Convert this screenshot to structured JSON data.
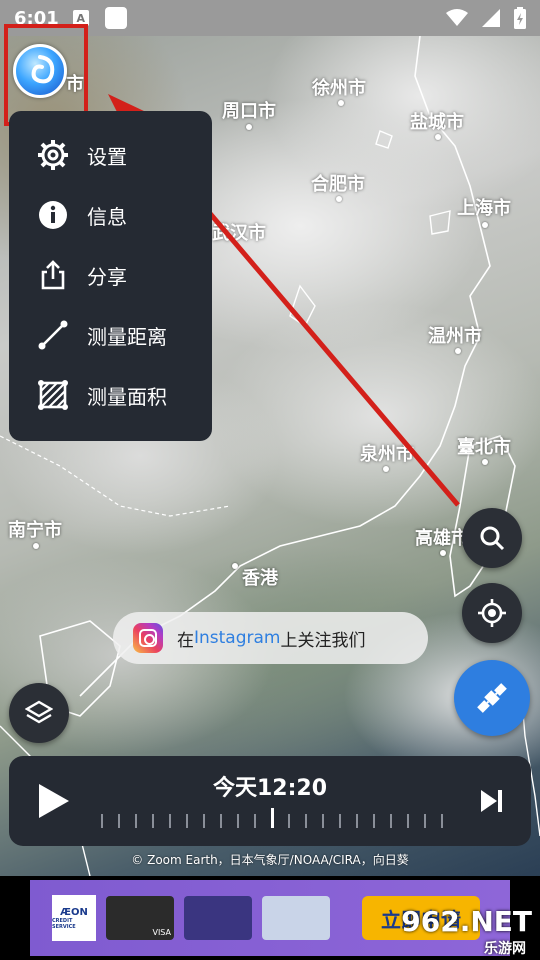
{
  "status_bar": {
    "time": "6:01",
    "a_badge": "A"
  },
  "cities": [
    {
      "name": "市"
    },
    {
      "name": "徐州市"
    },
    {
      "name": "周口市"
    },
    {
      "name": "盐城市"
    },
    {
      "name": "合肥市"
    },
    {
      "name": "上海市"
    },
    {
      "name": "武汉市"
    },
    {
      "name": "温州市"
    },
    {
      "name": "泉州市"
    },
    {
      "name": "臺北市"
    },
    {
      "name": "南宁市"
    },
    {
      "name": "高雄市"
    },
    {
      "name": "香港"
    }
  ],
  "menu": {
    "items": [
      {
        "label": "设置",
        "icon": "gear-icon"
      },
      {
        "label": "信息",
        "icon": "info-icon"
      },
      {
        "label": "分享",
        "icon": "share-icon"
      },
      {
        "label": "测量距离",
        "icon": "measure-distance-icon"
      },
      {
        "label": "测量面积",
        "icon": "measure-area-icon"
      }
    ]
  },
  "instagram": {
    "prefix": "在",
    "brand": "Instagram",
    "suffix": "上关注我们"
  },
  "timeline": {
    "time": "今天12:20"
  },
  "attribution": "© Zoom Earth，日本气象厅/NOAA/CIRA，向日葵",
  "ad": {
    "logo_text": "ÆON",
    "logo_sub": "CREDIT SERVICE",
    "card_labels": [
      "VISA",
      "",
      ""
    ],
    "cta": "立即申请"
  },
  "watermark": {
    "main": "962.NET",
    "sub": "乐游网"
  },
  "colors": {
    "accent": "#2e7ee0",
    "annotation_red": "#d3201a",
    "panel": "#252a33"
  }
}
